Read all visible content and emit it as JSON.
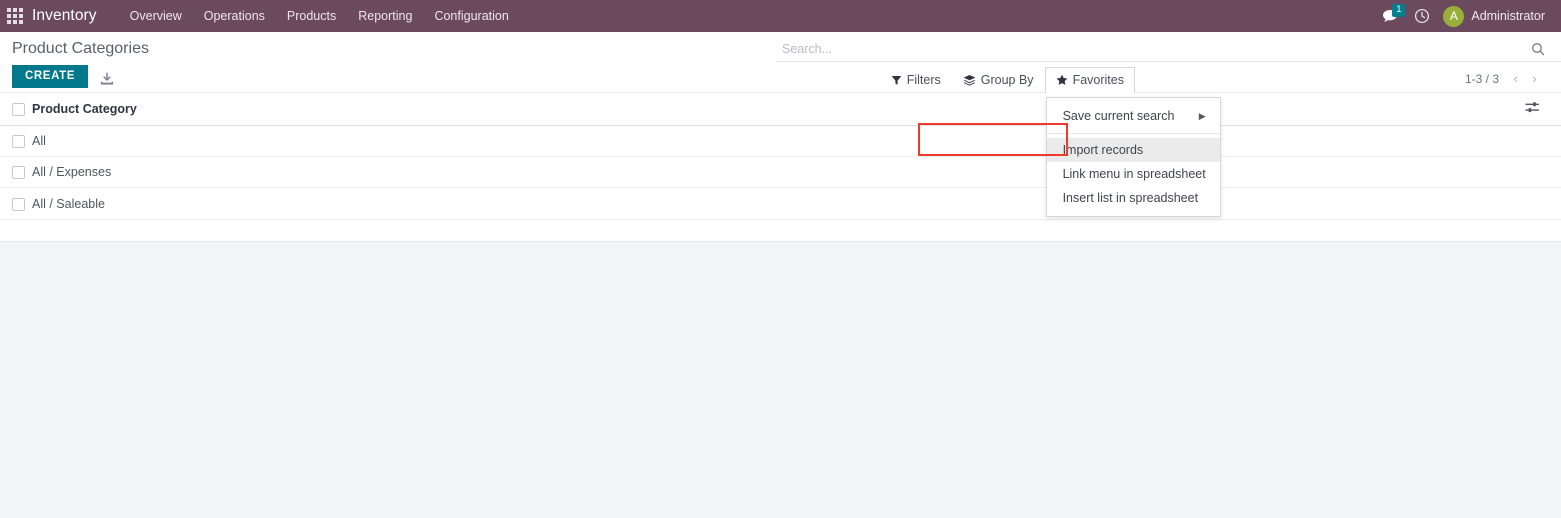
{
  "navbar": {
    "apps_icon": "apps-grid-icon",
    "brand": "Inventory",
    "menus": [
      {
        "label": "Overview"
      },
      {
        "label": "Operations"
      },
      {
        "label": "Products"
      },
      {
        "label": "Reporting"
      },
      {
        "label": "Configuration"
      }
    ],
    "messages_icon": "messages-icon",
    "messages_count": "1",
    "activities_icon": "clock-icon",
    "avatar_initial": "A",
    "username": "Administrator",
    "bar_color": "#6b4a5e",
    "badge_color": "#00808f",
    "avatar_color": "#9aae3a"
  },
  "control_panel": {
    "breadcrumb": "Product Categories",
    "create_label": "CREATE",
    "create_color": "#00798c",
    "import_icon": "import-download-icon",
    "search": {
      "placeholder": "Search...",
      "value": "",
      "search_icon": "search-magnifier-icon"
    },
    "filter_menus": [
      {
        "label": "Filters",
        "icon": "filter-funnel-icon",
        "open": false
      },
      {
        "label": "Group By",
        "icon": "group-by-layers-icon",
        "open": false
      },
      {
        "label": "Favorites",
        "icon": "favorites-star-icon",
        "open": true
      }
    ],
    "pager": {
      "count": "1-3 / 3",
      "prev_icon": "chevron-left-icon",
      "next_icon": "chevron-right-icon"
    }
  },
  "favorites_dropdown": {
    "items": [
      {
        "label": "Save current search",
        "has_submenu": true,
        "highlighted": false,
        "separator_after": true
      },
      {
        "label": "Import records",
        "has_submenu": false,
        "highlighted": true,
        "separator_after": false
      },
      {
        "label": "Link menu in spreadsheet",
        "has_submenu": false,
        "highlighted": false,
        "separator_after": false
      },
      {
        "label": "Insert list in spreadsheet",
        "has_submenu": false,
        "highlighted": false,
        "separator_after": false
      }
    ],
    "annotation_color": "#ef3b2d",
    "annotated_item": "Import records"
  },
  "list": {
    "columns": [
      "Product Category"
    ],
    "optional_columns_icon": "column-options-icon",
    "rows": [
      {
        "name": "All"
      },
      {
        "name": "All / Expenses"
      },
      {
        "name": "All / Saleable"
      }
    ]
  }
}
